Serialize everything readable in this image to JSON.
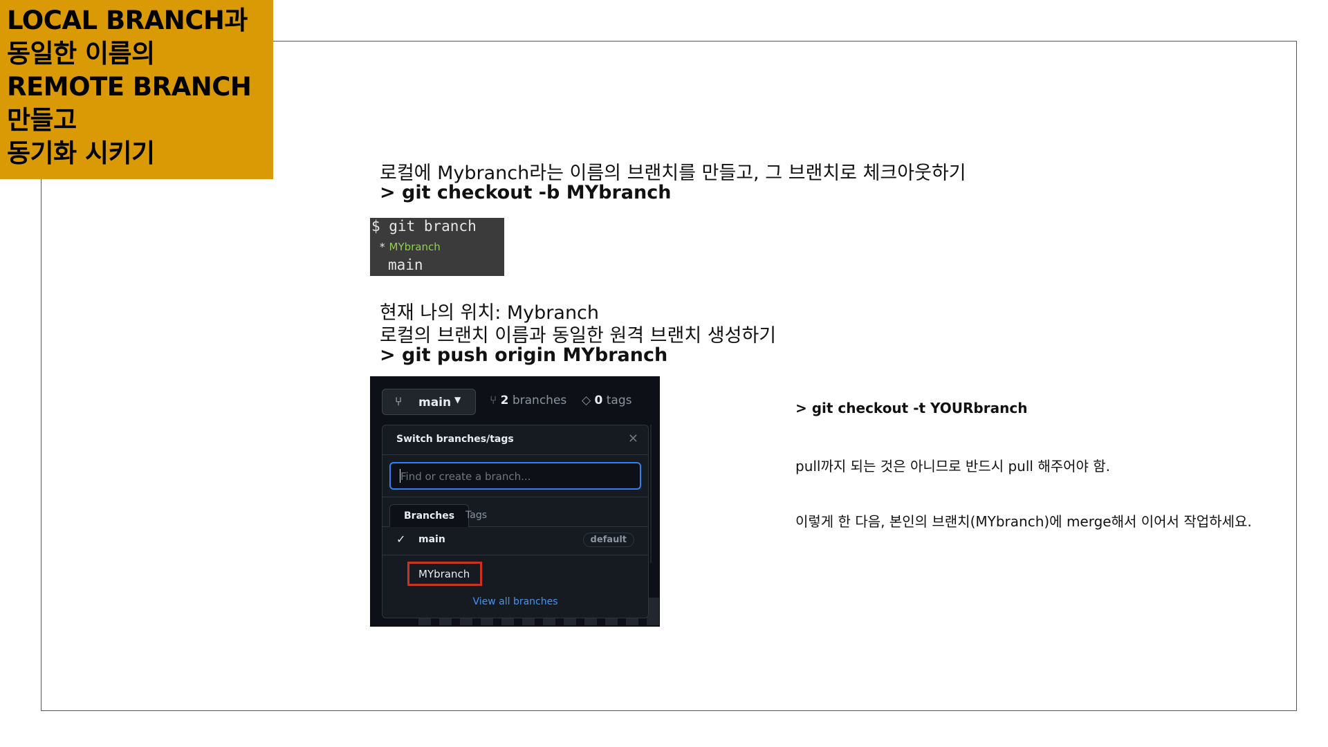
{
  "title_box": {
    "lines": [
      "LOCAL BRANCH과",
      "동일한 이름의",
      "REMOTE BRANCH",
      "만들고",
      "동기화 시키기"
    ]
  },
  "section1": {
    "desc": "로컬에 Mybranch라는 이름의 브랜치를 만들고, 그 브랜치로 체크아웃하기",
    "command": "> git checkout -b MYbranch"
  },
  "terminal": {
    "line1": "$ git branch",
    "star": "*",
    "current_branch": "MYbranch",
    "other_branch": "main",
    "current_color": "#8fd14f"
  },
  "section2": {
    "line1": "현재 나의 위치: Mybranch",
    "line2": "로컬의 브랜치 이름과 동일한 원격 브랜치 생성하기",
    "command": "> git push origin MYbranch"
  },
  "github": {
    "branch_button": "main",
    "branches_count": "2",
    "branches_label": "branches",
    "tags_count": "0",
    "tags_label": "tags",
    "dropdown_title": "Switch branches/tags",
    "search_placeholder": "Find or create a branch...",
    "tab_branches": "Branches",
    "tab_tags": "Tags",
    "main_branch": "main",
    "default_badge": "default",
    "highlighted_branch": "MYbranch",
    "view_all": "View all branches",
    "highlight_color": "#d0301c"
  },
  "notes": {
    "command": "> git checkout -t YOURbranch",
    "note1": "pull까지 되는 것은 아니므로 반드시 pull 해주어야 함.",
    "note2": "이렇게 한 다음, 본인의 브랜치(MYbranch)에 merge해서 이어서 작업하세요."
  },
  "colors": {
    "title_bg": "#d99a06",
    "github_bg": "#0d1117",
    "link": "#4493f8"
  }
}
